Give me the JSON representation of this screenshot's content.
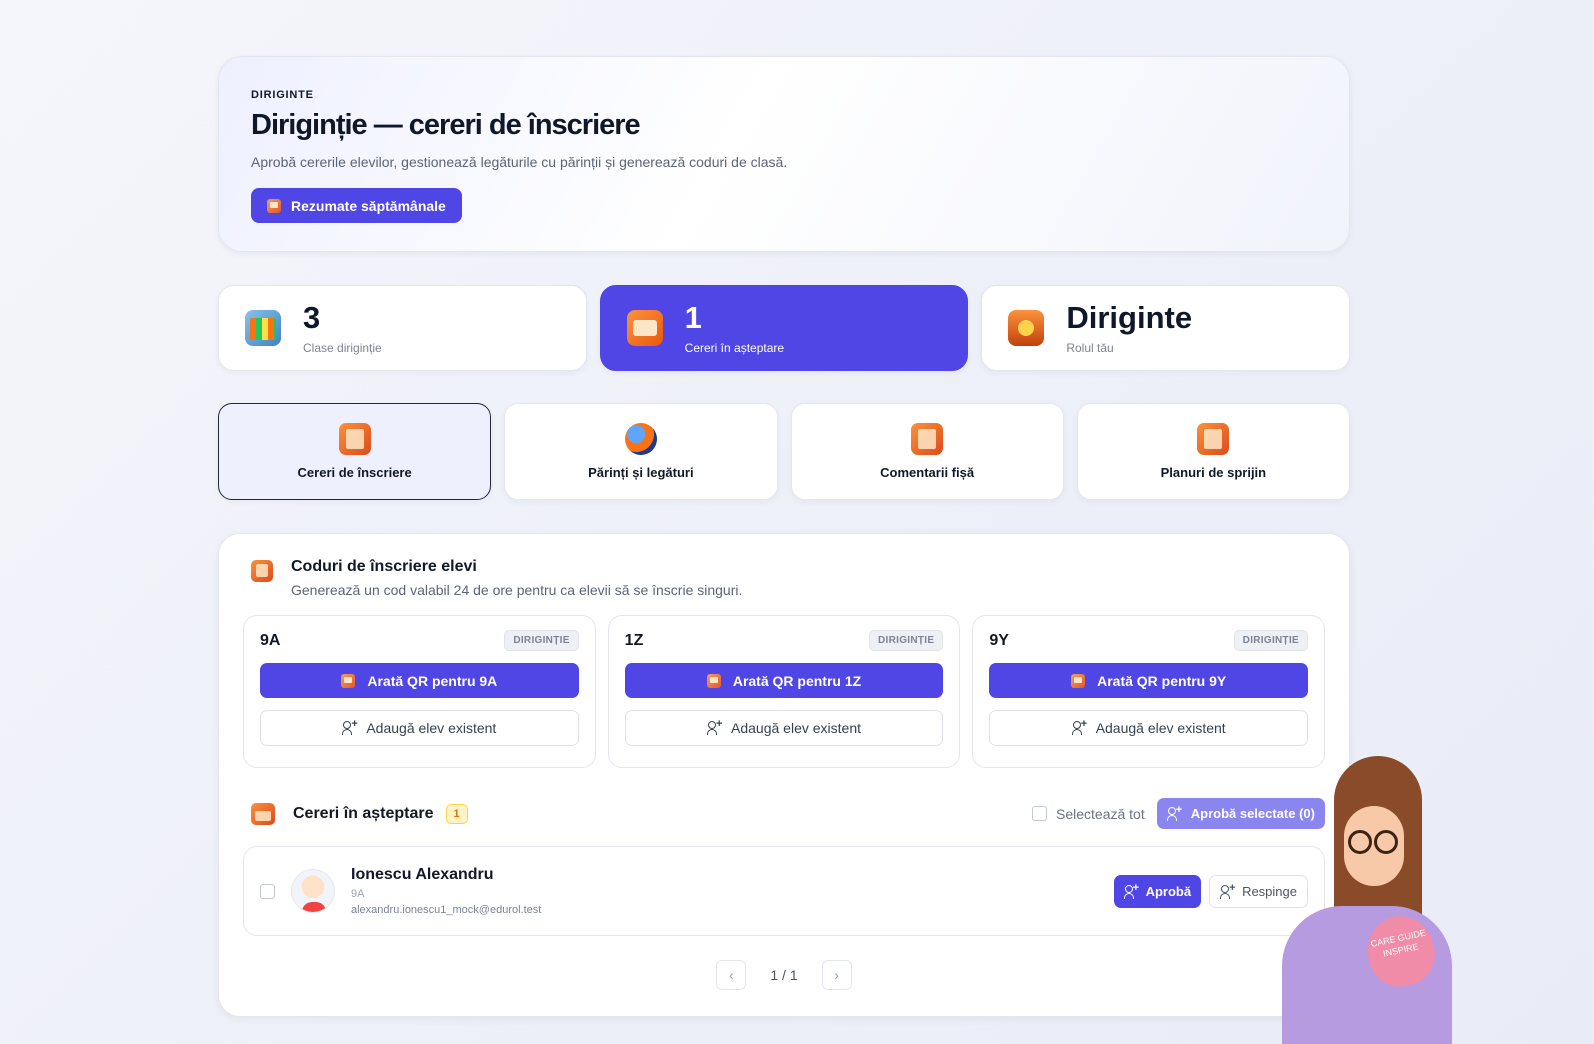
{
  "header": {
    "eyebrow": "DIRIGINTE",
    "title": "Diriginție — cereri de înscriere",
    "subtitle": "Aprobă cererile elevilor, gestionează legăturile cu părinții și generează coduri de clasă.",
    "summary_button": "Rezumate săptămânale"
  },
  "stats": [
    {
      "value": "3",
      "label": "Clase diriginție",
      "icon": "classroom-icon"
    },
    {
      "value": "1",
      "label": "Cereri în așteptare",
      "icon": "inbox-box-icon"
    },
    {
      "value": "Diriginte",
      "label": "Rolul tău",
      "icon": "shield-badge-icon"
    }
  ],
  "tabs": [
    {
      "label": "Cereri de înscriere",
      "icon": "enrollment-icon",
      "active": true
    },
    {
      "label": "Părinți și legături",
      "icon": "globe-people-icon",
      "active": false
    },
    {
      "label": "Comentarii fișă",
      "icon": "comments-sheet-icon",
      "active": false
    },
    {
      "label": "Planuri de sprijin",
      "icon": "support-plan-icon",
      "active": false
    }
  ],
  "codes": {
    "title": "Coduri de înscriere elevi",
    "subtitle": "Generează un cod valabil 24 de ore pentru ca elevii să se înscrie singuri.",
    "classes": [
      {
        "name": "9A",
        "badge": "DIRIGINȚIE",
        "qr_label": "Arată QR pentru 9A",
        "add_label": "Adaugă elev existent"
      },
      {
        "name": "1Z",
        "badge": "DIRIGINȚIE",
        "qr_label": "Arată QR pentru 1Z",
        "add_label": "Adaugă elev existent"
      },
      {
        "name": "9Y",
        "badge": "DIRIGINȚIE",
        "qr_label": "Arată QR pentru 9Y",
        "add_label": "Adaugă elev existent"
      }
    ]
  },
  "pending": {
    "title": "Cereri în așteptare",
    "count": "1",
    "select_all": "Selectează tot",
    "approve_selected": "Aprobă selectate (0)",
    "requests": [
      {
        "name": "Ionescu Alexandru",
        "class": "9A",
        "email": "alexandru.ionescu1_mock@edurol.test",
        "approve": "Aprobă",
        "reject": "Respinge"
      }
    ],
    "pagination": "1 / 1"
  },
  "mascot": {
    "sign_text": "CARE GUIDE INSPIRE"
  },
  "colors": {
    "accent": "#4f46e5",
    "accent_light": "#8b85ef",
    "badge_warn": "#d97706"
  }
}
